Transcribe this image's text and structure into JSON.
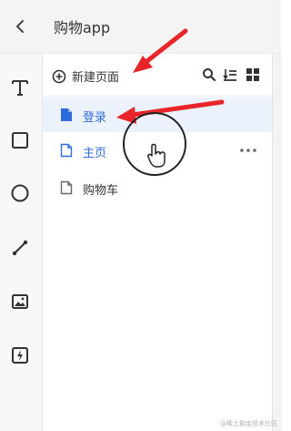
{
  "header": {
    "title": "购物app"
  },
  "tools": [
    {
      "name": "text-tool",
      "icon": "text-T-icon"
    },
    {
      "name": "rectangle-tool",
      "icon": "square-icon"
    },
    {
      "name": "circle-tool",
      "icon": "circle-icon"
    },
    {
      "name": "line-tool",
      "icon": "line-icon"
    },
    {
      "name": "image-tool",
      "icon": "image-icon"
    },
    {
      "name": "flash-tool",
      "icon": "lightning-icon"
    }
  ],
  "panel": {
    "add_page_label": "新建页面",
    "pages": [
      {
        "label": "登录",
        "state": "selected"
      },
      {
        "label": "主页",
        "state": "hover"
      },
      {
        "label": "购物车",
        "state": "normal"
      }
    ]
  },
  "colors": {
    "accent": "#2f6bd8",
    "annotation_red": "#e8262a",
    "selected_bg": "#ecf2fb"
  },
  "watermark": "@稀土掘金技术社区"
}
